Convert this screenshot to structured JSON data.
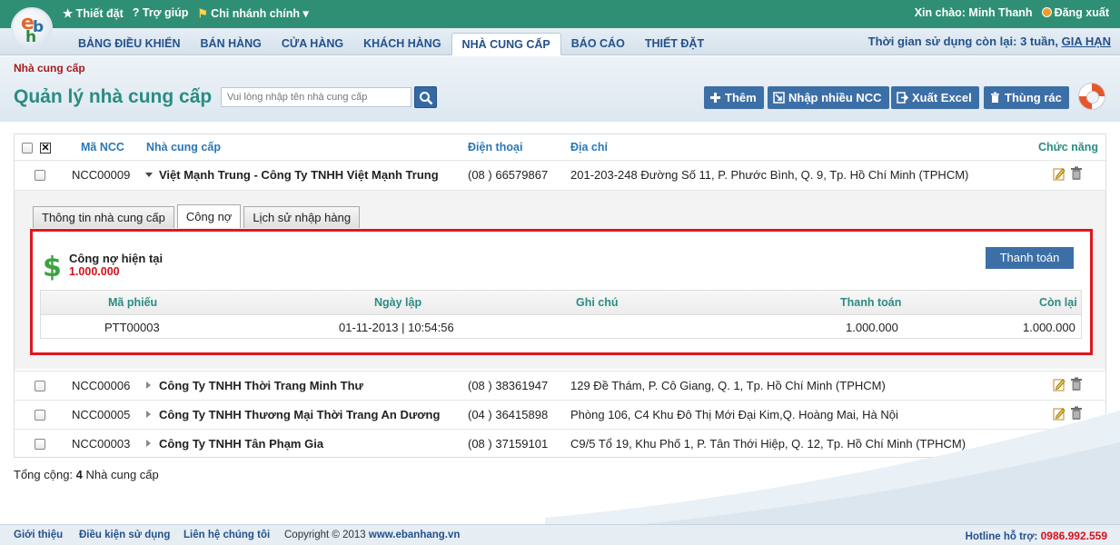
{
  "topbar": {
    "settings": "★ Thiết đặt",
    "help": "? Trợ giúp",
    "branch": "Chi nhánh chính",
    "greeting": "Xin chào: Minh Thanh",
    "logout": "Đăng xuất"
  },
  "nav": {
    "tabs": [
      "BẢNG ĐIỀU KHIỂN",
      "BÁN HÀNG",
      "CỬA HÀNG",
      "KHÁCH HÀNG",
      "NHÀ CUNG CẤP",
      "BÁO CÁO",
      "THIẾT ĐẶT"
    ],
    "active": "NHÀ CUNG CẤP",
    "usage_text": "Thời gian sử dụng còn lại: 3 tuần,",
    "usage_link": "GIA HẠN"
  },
  "header": {
    "breadcrumb": "Nhà cung cấp",
    "title": "Quản lý nhà cung cấp",
    "search_placeholder": "Vui lòng nhập tên nhà cung cấp",
    "actions": {
      "add": "Thêm",
      "import": "Nhập nhiều NCC",
      "export": "Xuất Excel",
      "trash": "Thùng rác"
    }
  },
  "table": {
    "headers": {
      "code": "Mã NCC",
      "supplier": "Nhà cung cấp",
      "phone": "Điện thoại",
      "address": "Địa chỉ",
      "function": "Chức năng"
    },
    "rows": [
      {
        "code": "NCC00009",
        "name": "Việt Mạnh Trung - Công Ty TNHH Việt Mạnh Trung",
        "phone": "(08 ) 66579867",
        "address": "201-203-248 Đường Số 11, P. Phước Bình, Q. 9, Tp. Hồ Chí Minh (TPHCM)"
      },
      {
        "code": "NCC00006",
        "name": "Công Ty TNHH Thời Trang Minh Thư",
        "phone": "(08 ) 38361947",
        "address": "129 Đề Thám, P. Cô Giang, Q. 1, Tp. Hồ Chí Minh (TPHCM)"
      },
      {
        "code": "NCC00005",
        "name": "Công Ty TNHH Thương Mại Thời Trang An Dương",
        "phone": "(04 ) 36415898",
        "address": "Phòng 106, C4 Khu Đô Thị Mới Đại Kim,Q. Hoàng Mai, Hà Nội"
      },
      {
        "code": "NCC00003",
        "name": "Công Ty TNHH Tân Phạm Gia",
        "phone": "(08 ) 37159101",
        "address": "C9/5 Tổ 19, Khu Phố 1, P. Tân Thới Hiệp, Q. 12, Tp. Hồ Chí Minh (TPHCM)"
      }
    ]
  },
  "detail": {
    "tabs": [
      "Thông tin nhà cung cấp",
      "Công nợ",
      "Lịch sử nhập hàng"
    ],
    "active_tab": "Công nợ",
    "debt_label": "Công nợ hiện tại",
    "debt_value": "1.000.000",
    "pay_button": "Thanh toán",
    "sub_headers": {
      "receipt": "Mã phiếu",
      "date": "Ngày lập",
      "note": "Ghi chú",
      "paid": "Thanh toán",
      "remaining": "Còn lại"
    },
    "sub_rows": [
      {
        "receipt": "PTT00003",
        "date": "01-11-2013 | 10:54:56",
        "note": "",
        "paid": "1.000.000",
        "remaining": "1.000.000"
      }
    ]
  },
  "summary": {
    "prefix": "Tổng cộng:",
    "count": "4",
    "suffix": "Nhà cung cấp"
  },
  "footer": {
    "about": "Giới thiệu",
    "terms": "Điều kiện sử dụng",
    "contact": "Liên hệ chúng tôi",
    "copyright": "Copyright © 2013",
    "site": "www.ebanhang.vn",
    "hotline_label": "Hotline hỗ trợ:",
    "hotline": "0986.992.559"
  },
  "colors": {
    "topbar": "#2f8f74",
    "nav_text": "#23518c",
    "title": "#2a8c82",
    "button": "#3d6fa7",
    "highlight": "#e0171c",
    "debt": "#d9111a"
  }
}
